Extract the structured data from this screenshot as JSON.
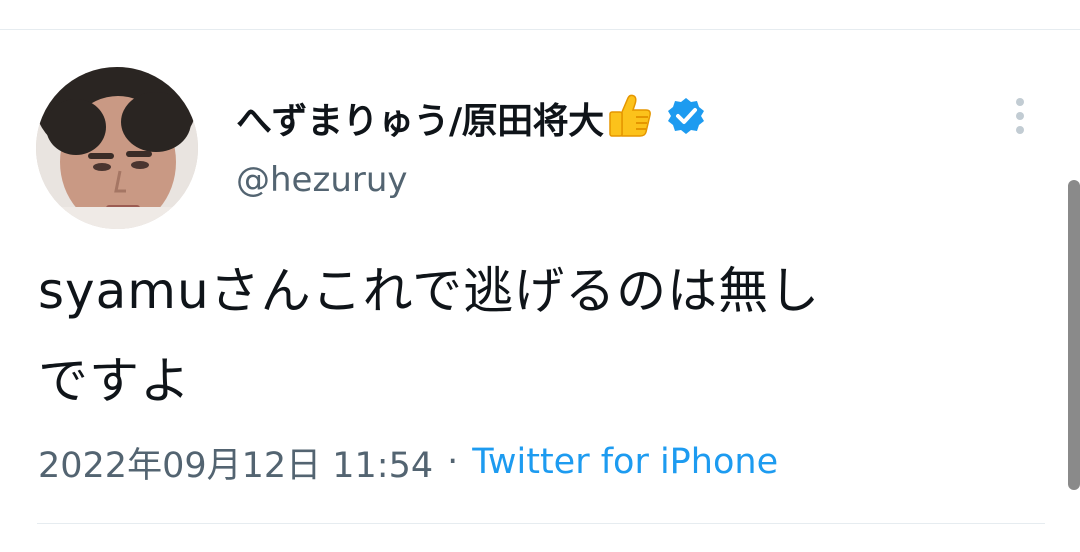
{
  "tweet": {
    "author": {
      "display_name": "へずまりゅう/原田将大",
      "name_emoji": "thumbs-up-emoji",
      "verified_badge": "verified-icon",
      "handle": "@hezuruy"
    },
    "text_lines": [
      "syamuさんこれで逃げるのは無し",
      "ですよ"
    ],
    "timestamp": "2022年09月12日 11:54",
    "separator": "·",
    "source": "Twitter for iPhone",
    "more_menu": "more-options-icon"
  },
  "colors": {
    "text_primary": "#0f1419",
    "text_secondary": "#536471",
    "accent": "#1d9bf0",
    "divider": "#e6ecf0"
  }
}
